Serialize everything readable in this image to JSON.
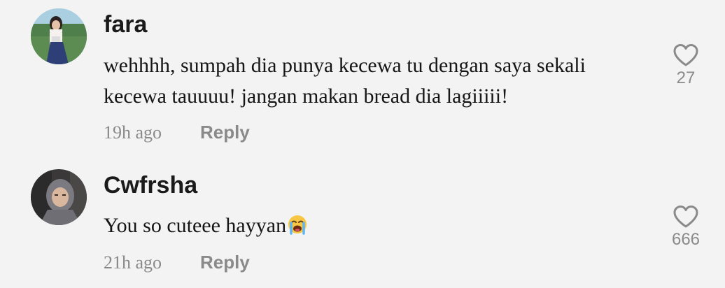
{
  "comments": [
    {
      "username": "fara",
      "text_lines": [
        "wehhhh, sumpah dia punya kecewa tu dengan saya sekali",
        "kecewa tauuuu! jangan makan bread dia lagiiiii!"
      ],
      "time": "19h ago",
      "reply_label": "Reply",
      "like_count": "27"
    },
    {
      "username": "Cwfrsha",
      "text": "You so cuteee hayyan",
      "emoji": "loudly-crying-face",
      "time": "21h ago",
      "reply_label": "Reply",
      "like_count": "666"
    }
  ],
  "colors": {
    "background": "#f3f3f3",
    "username": "#1a1a1a",
    "text": "#161616",
    "muted": "#8a8a8a"
  }
}
